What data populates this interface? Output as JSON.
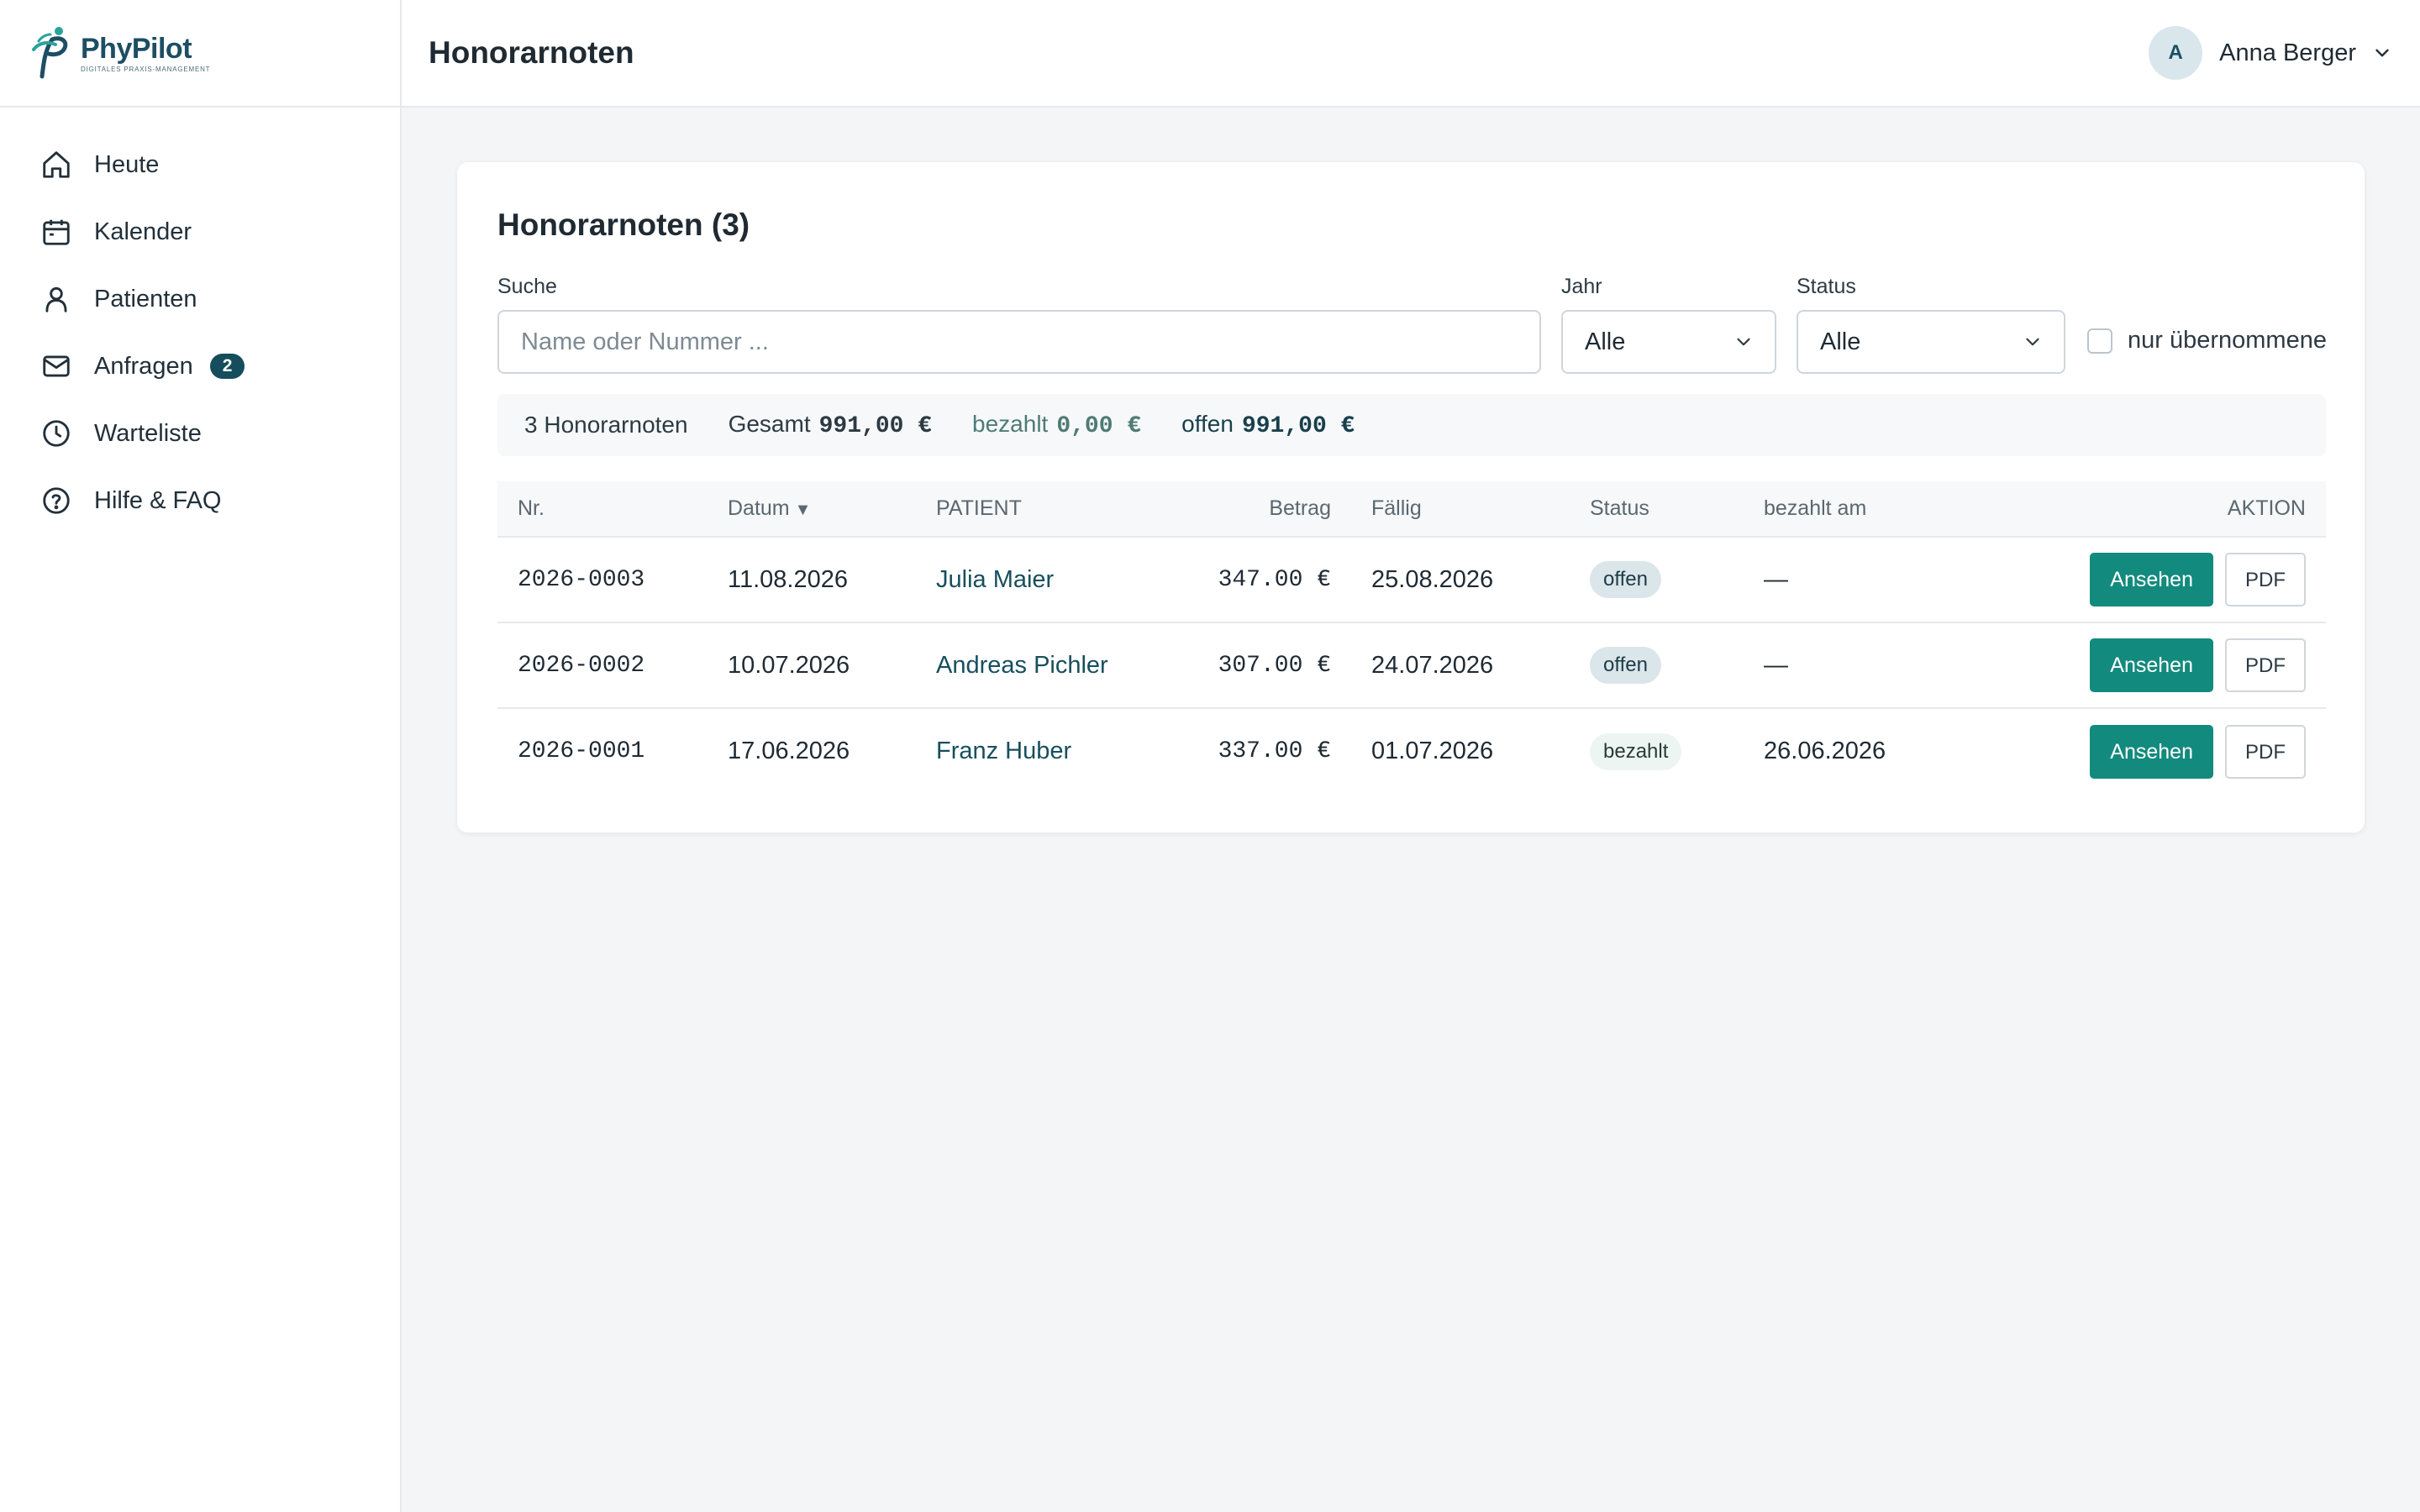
{
  "brand": {
    "name": "PhyPilot",
    "tagline": "DIGITALES PRAXIS-MANAGEMENT"
  },
  "sidebar": {
    "items": [
      {
        "label": "Heute",
        "icon": "home-icon"
      },
      {
        "label": "Kalender",
        "icon": "calendar-icon"
      },
      {
        "label": "Patienten",
        "icon": "user-icon"
      },
      {
        "label": "Anfragen",
        "icon": "mail-icon",
        "badge": "2"
      },
      {
        "label": "Warteliste",
        "icon": "clock-icon"
      },
      {
        "label": "Hilfe & FAQ",
        "icon": "help-icon"
      }
    ]
  },
  "header": {
    "title": "Honorarnoten",
    "user": {
      "initial": "A",
      "name": "Anna Berger"
    }
  },
  "card": {
    "title": "Honorarnoten (3)"
  },
  "filters": {
    "search_label": "Suche",
    "search_placeholder": "Name oder Nummer ...",
    "search_value": "",
    "year_label": "Jahr",
    "year_value": "Alle",
    "status_label": "Status",
    "status_value": "Alle",
    "only_taken_label": "nur übernommene"
  },
  "summary": {
    "count_text": "3 Honorarnoten",
    "total_label": "Gesamt",
    "total_value": "991,00 €",
    "paid_label": "bezahlt",
    "paid_value": "0,00 €",
    "open_label": "offen",
    "open_value": "991,00 €"
  },
  "table": {
    "headers": {
      "nr": "Nr.",
      "datum": "Datum",
      "sort_indicator": "▼",
      "patient": "PATIENT",
      "betrag": "Betrag",
      "faellig": "Fällig",
      "status": "Status",
      "paid_on": "bezahlt am",
      "action": "AKTION"
    },
    "view_label": "Ansehen",
    "pdf_label": "PDF",
    "rows": [
      {
        "nr": "2026-0003",
        "datum": "11.08.2026",
        "patient": "Julia Maier",
        "betrag": "347.00 €",
        "faellig": "25.08.2026",
        "status": "offen",
        "paid_on": "—"
      },
      {
        "nr": "2026-0002",
        "datum": "10.07.2026",
        "patient": "Andreas Pichler",
        "betrag": "307.00 €",
        "faellig": "24.07.2026",
        "status": "offen",
        "paid_on": "—"
      },
      {
        "nr": "2026-0001",
        "datum": "17.06.2026",
        "patient": "Franz Huber",
        "betrag": "337.00 €",
        "faellig": "01.07.2026",
        "status": "bezahlt",
        "paid_on": "26.06.2026"
      }
    ]
  },
  "colors": {
    "accent": "#138a7e",
    "brand": "#1c4e64",
    "badge": "#154d5c"
  }
}
